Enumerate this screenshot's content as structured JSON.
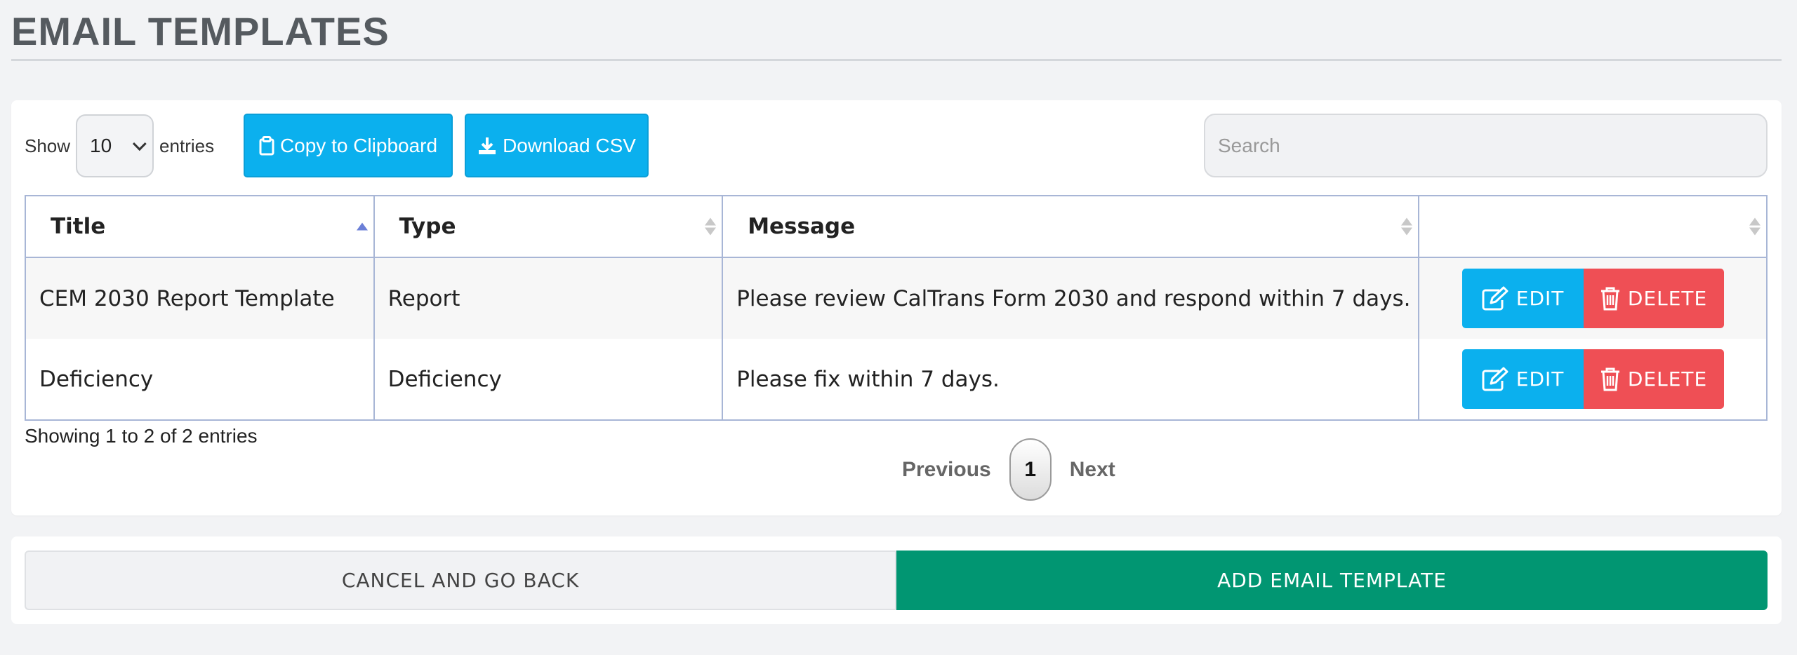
{
  "page": {
    "title": "EMAIL TEMPLATES"
  },
  "controls": {
    "show_label": "Show",
    "entries_value": "10",
    "entries_label": "entries",
    "copy_label": "Copy to Clipboard",
    "download_label": "Download CSV",
    "search_placeholder": "Search"
  },
  "table": {
    "columns": [
      "Title",
      "Type",
      "Message",
      ""
    ],
    "rows": [
      {
        "title": "CEM 2030 Report Template",
        "type": "Report",
        "message": "Please review CalTrans Form 2030 and respond within 7 days."
      },
      {
        "title": "Deficiency",
        "type": "Deficiency",
        "message": "Please fix within 7 days."
      }
    ],
    "edit_label": "EDIT",
    "delete_label": "DELETE"
  },
  "footer_info": "Showing 1 to 2 of 2 entries",
  "pagination": {
    "previous": "Previous",
    "current": "1",
    "next": "Next"
  },
  "bottom_actions": {
    "cancel": "CANCEL AND GO BACK",
    "add": "ADD EMAIL TEMPLATE"
  },
  "colors": {
    "blue": "#0bb0ee",
    "red": "#ef4f55",
    "green": "#019672"
  }
}
